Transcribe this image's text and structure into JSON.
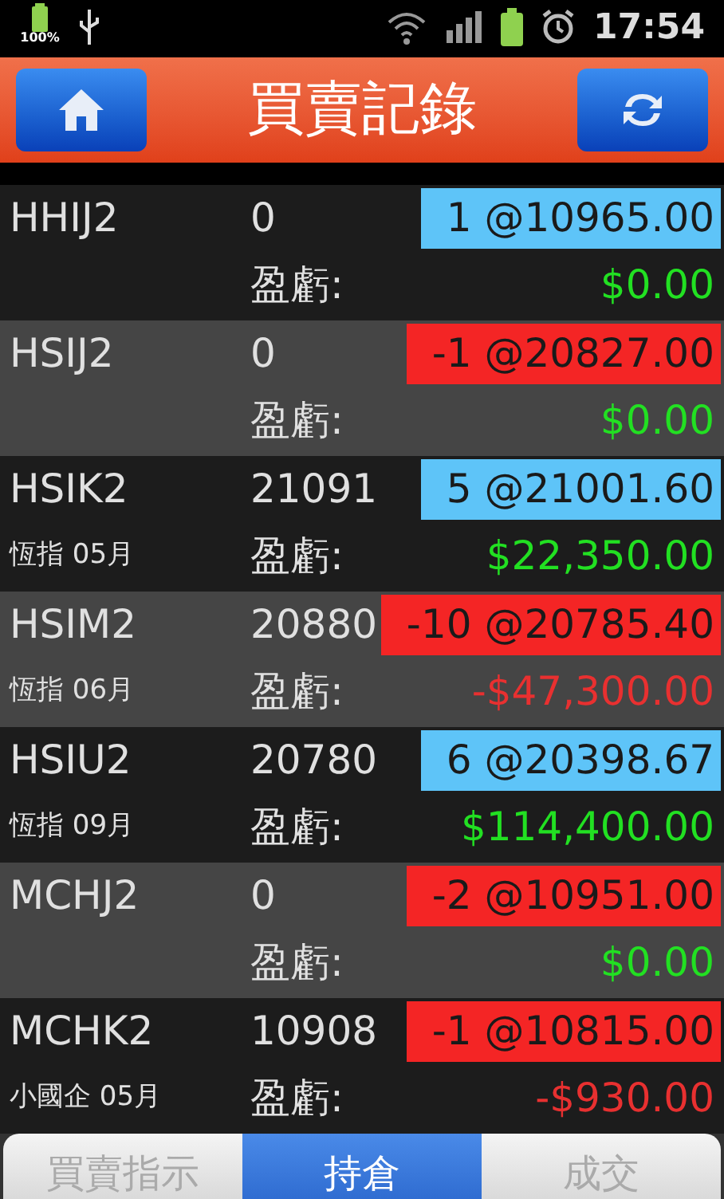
{
  "status_bar": {
    "battery_percent": "100%",
    "time": "17:54"
  },
  "header": {
    "title": "買賣記錄"
  },
  "rows": [
    {
      "symbol": "HHIJ2",
      "price": "0",
      "position": {
        "kind": "buy",
        "text": "1 @10965.00"
      },
      "pnl_label": "盈虧:",
      "pnl": {
        "kind": "gain",
        "text": "$0.00"
      }
    },
    {
      "symbol": "HSIJ2",
      "price": "0",
      "position": {
        "kind": "sell",
        "text": "-1 @20827.00"
      },
      "pnl_label": "盈虧:",
      "pnl": {
        "kind": "gain",
        "text": "$0.00"
      }
    },
    {
      "symbol": "HSIK2",
      "subtitle": "恆指 05月",
      "price": "21091",
      "position": {
        "kind": "buy",
        "text": "5 @21001.60"
      },
      "pnl_label": "盈虧:",
      "pnl": {
        "kind": "gain",
        "text": "$22,350.00"
      }
    },
    {
      "symbol": "HSIM2",
      "subtitle": "恆指 06月",
      "price": "20880",
      "position": {
        "kind": "sell",
        "text": "-10 @20785.40"
      },
      "pnl_label": "盈虧:",
      "pnl": {
        "kind": "loss",
        "text": "-$47,300.00"
      }
    },
    {
      "symbol": "HSIU2",
      "subtitle": "恆指 09月",
      "price": "20780",
      "position": {
        "kind": "buy",
        "text": "6 @20398.67"
      },
      "pnl_label": "盈虧:",
      "pnl": {
        "kind": "gain",
        "text": "$114,400.00"
      }
    },
    {
      "symbol": "MCHJ2",
      "price": "0",
      "position": {
        "kind": "sell",
        "text": "-2 @10951.00"
      },
      "pnl_label": "盈虧:",
      "pnl": {
        "kind": "gain",
        "text": "$0.00"
      }
    },
    {
      "symbol": "MCHK2",
      "subtitle": "小國企 05月",
      "price": "10908",
      "position": {
        "kind": "sell",
        "text": "-1 @10815.00"
      },
      "pnl_label": "盈虧:",
      "pnl": {
        "kind": "loss",
        "text": "-$930.00"
      }
    }
  ],
  "tabs": [
    {
      "label": "買賣指示",
      "selected": false
    },
    {
      "label": "持倉",
      "selected": true
    },
    {
      "label": "成交",
      "selected": false
    }
  ]
}
